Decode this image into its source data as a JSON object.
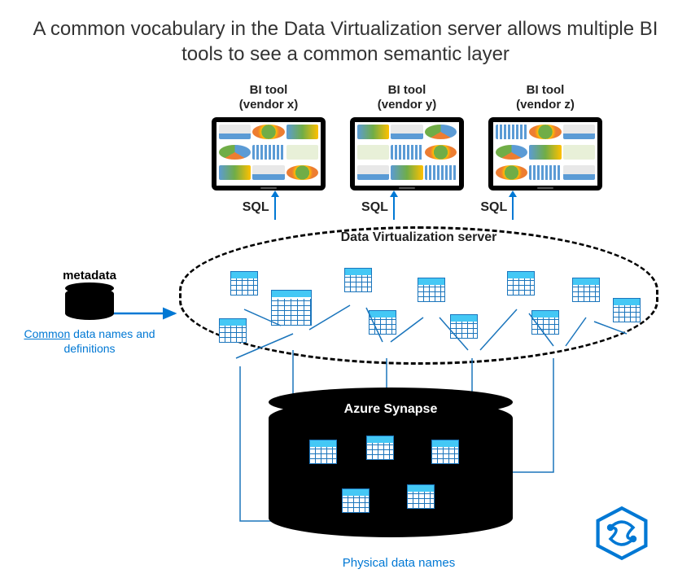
{
  "title": "A common vocabulary in the Data Virtualization server allows multiple BI tools to see a common semantic layer",
  "bi_tools": [
    {
      "line1": "BI tool",
      "line2": "(vendor x)",
      "sql": "SQL"
    },
    {
      "line1": "BI tool",
      "line2": "(vendor y)",
      "sql": "SQL"
    },
    {
      "line1": "BI tool",
      "line2": "(vendor z)",
      "sql": "SQL"
    }
  ],
  "dv_server_label": "Data Virtualization server",
  "metadata": {
    "heading": "metadata",
    "line_emphasis": "Common",
    "line_rest": " data names and definitions"
  },
  "synapse_label": "Azure Synapse",
  "physical_label": "Physical data names"
}
